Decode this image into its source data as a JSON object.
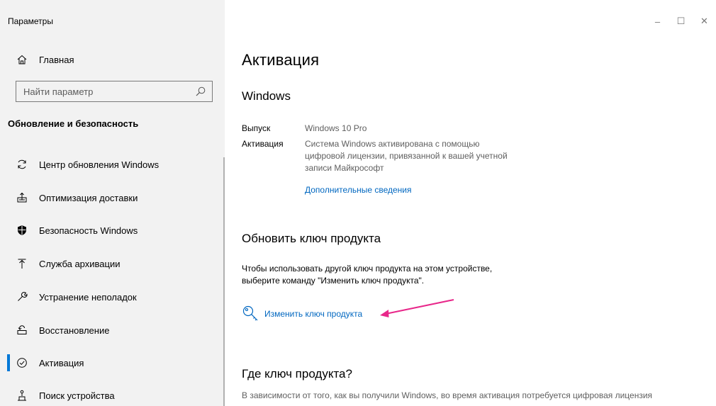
{
  "window": {
    "title": "Параметры",
    "controls": {
      "minimize": "–",
      "maximize": "☐",
      "close": "✕"
    }
  },
  "sidebar": {
    "home": {
      "label": "Главная",
      "icon": "home-icon"
    },
    "search": {
      "placeholder": "Найти параметр",
      "icon": "search-icon"
    },
    "section_title": "Обновление и безопасность",
    "items": [
      {
        "label": "Центр обновления Windows",
        "icon": "sync-icon",
        "active": false
      },
      {
        "label": "Оптимизация доставки",
        "icon": "delivery-icon",
        "active": false
      },
      {
        "label": "Безопасность Windows",
        "icon": "shield-icon",
        "active": false
      },
      {
        "label": "Служба архивации",
        "icon": "backup-icon",
        "active": false
      },
      {
        "label": "Устранение неполадок",
        "icon": "wrench-icon",
        "active": false
      },
      {
        "label": "Восстановление",
        "icon": "recovery-icon",
        "active": false
      },
      {
        "label": "Активация",
        "icon": "activation-check-icon",
        "active": true
      },
      {
        "label": "Поиск устройства",
        "icon": "find-device-icon",
        "active": false
      }
    ],
    "accent_color": "#0078d7"
  },
  "main": {
    "title": "Активация",
    "windows_heading": "Windows",
    "edition_label": "Выпуск",
    "edition_value": "Windows 10 Pro",
    "activation_label": "Активация",
    "activation_value_lines": [
      "Система Windows активирована с помощью",
      "цифровой лицензии, привязанной к вашей учетной",
      "записи Майкрософт"
    ],
    "more_info_link": "Дополнительные сведения",
    "update_key_heading": "Обновить ключ продукта",
    "update_key_text_lines": [
      "Чтобы использовать другой ключ продукта на этом устройстве,",
      "выберите команду \"Изменить ключ продукта\"."
    ],
    "change_key_link": "Изменить ключ продукта",
    "where_key_heading": "Где ключ продукта?",
    "where_key_text": "В зависимости от того, как вы получили Windows, во время активация потребуется цифровая лицензия",
    "link_color": "#0067c0",
    "annotation_arrow_color": "#e8278a"
  }
}
